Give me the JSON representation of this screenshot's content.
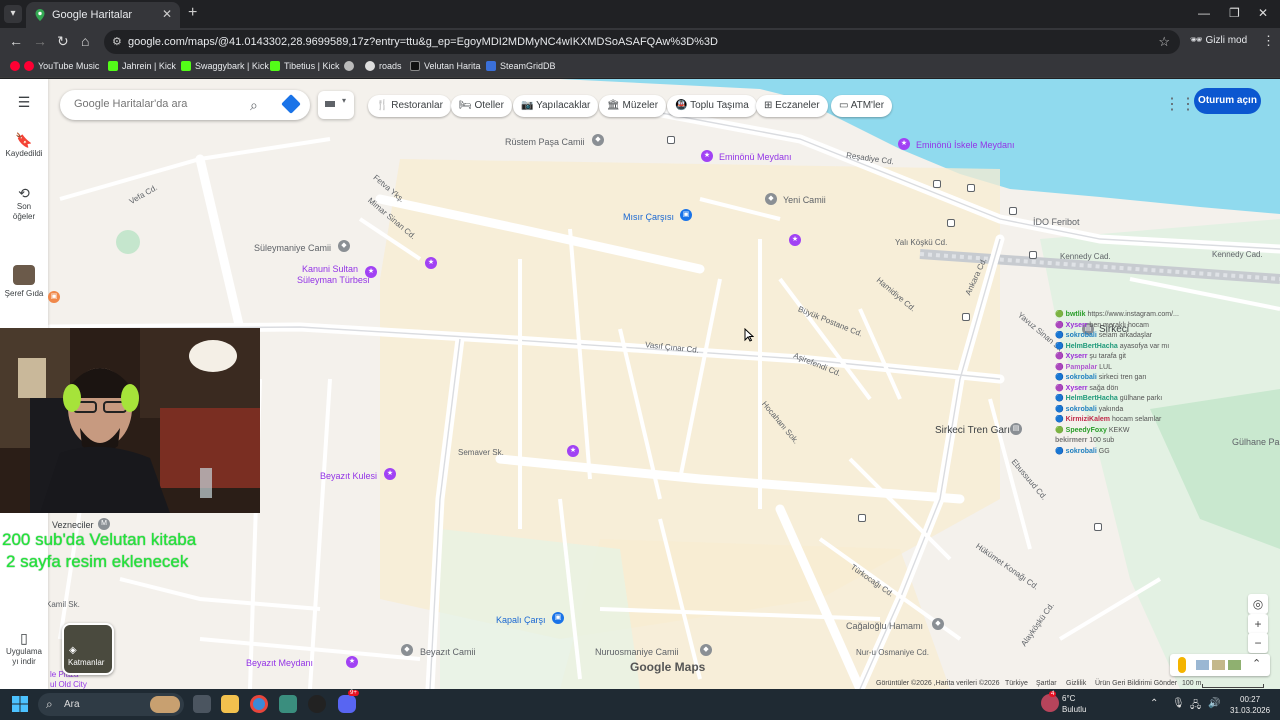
{
  "browser": {
    "tab_title": "Google Haritalar",
    "url": "google.com/maps/@41.0143302,28.9699589,17z?entry=ttu&g_ep=EgoyMDI2MDMyNC4wIKXMDSoASAFQAw%3D%3D",
    "incognito_label": "Gizli mod",
    "bookmarks": [
      "YouTube Music",
      "Jahrein | Kick",
      "Swaggybark | Kick",
      "Tibetius | Kick",
      "roads",
      "Velutan Harita",
      "SteamGridDB"
    ]
  },
  "maps": {
    "search_placeholder": "Google Haritalar'da ara",
    "chips": [
      "Restoranlar",
      "Oteller",
      "Yapılacaklar",
      "Müzeler",
      "Toplu Taşıma",
      "Eczaneler",
      "ATM'ler"
    ],
    "signin_label": "Oturum açın",
    "sidebar": {
      "saved": "Kaydedildi",
      "recent": "Son öğeler",
      "recent_item": "Şeref Gıda",
      "get_app": "Uygulama yı indir"
    },
    "layers_label": "Katmanlar",
    "logo": "Google Maps",
    "attribution": {
      "imagery": "Görüntüler ©2026 ,Harita verileri ©2026",
      "country": "Türkiye",
      "terms": "Şartlar",
      "privacy": "Gizlilik",
      "feedback": "Ürün Geri Bildirimi Gönder",
      "scale": "100 m"
    },
    "places": {
      "rustem_pasa": "Rüstem Paşa Camii",
      "eminonu_meydani": "Eminönü Meydanı",
      "eminonu_iskele": "Eminönü İskele Meydanı",
      "yeni_camii": "Yeni Camii",
      "misir_carsisi": "Mısır Çarşısı",
      "suleymaniye": "Süleymaniye Camii",
      "kanuni_1": "Kanuni Sultan",
      "kanuni_2": "Süleyman Türbesi",
      "ido": "İDO Feribot",
      "sirkeci": "Sirkeci",
      "sirkeci_tren": "Sirkeci Tren Garı",
      "beyazit_kulesi": "Beyazıt Kulesi",
      "vezneciler": "Vezneciler",
      "kapali_carsi": "Kapalı Çarşı",
      "beyazit_camii": "Beyazıt Camii",
      "nuruosmaniye": "Nuruosmaniye Camii",
      "cagaloglu": "Cağaloğlu Hamamı",
      "nuru_osmaniye_cd": "Nur-u Osmaniye Cd.",
      "beyazit_meydani": "Beyazıt Meydanı",
      "gulhane": "Gülhane Pa",
      "old_city_1": "le Plaza",
      "old_city_2": "ul Old City"
    },
    "streets": [
      "Reşadiye Cd.",
      "Kennedy Cad.",
      "Kennedy Cad.",
      "Vasıf Çınar Cd.",
      "Hamidiye Cd.",
      "Büyük Postane Cd.",
      "Aşirefendi Cd.",
      "Hocahanı Sok.",
      "Semaver Sk.",
      "Fetva Ykş.",
      "Vefa Cd.",
      "Mimar Sinan Cd.",
      "Yavuz Sinan Sk.",
      "Hükümet Konağı Cd.",
      "Türkocağı Cd.",
      "Alayköşkü Cd.",
      "Ebussuud Cd.",
      "Ankara Cd.",
      "Yalı Köşkü Cd.",
      "Kamil Sk."
    ]
  },
  "stream_overlay": {
    "line1": "200 sub'da Velutan kitaba",
    "line2": "2 sayfa resim eklenecek",
    "chat": [
      {
        "name": "bwtlik",
        "msg": "https://www.instagram.com/..."
      },
      {
        "name": "Xyserr",
        "msg": "ben meraklı hocam"
      },
      {
        "name": "sokrobali",
        "msg": "selam arkadaşlar"
      },
      {
        "name": "HelmBertHacha",
        "msg": "ayasofya var mı"
      },
      {
        "name": "Xyserr",
        "msg": "şu tarafa git"
      },
      {
        "name": "Pampalar",
        "msg": "LUL"
      },
      {
        "name": "sokrobali",
        "msg": "sirkeci tren garı"
      },
      {
        "name": "Xyserr",
        "msg": "sağa dön"
      },
      {
        "name": "HelmBertHacha",
        "msg": "gülhane parkı"
      },
      {
        "name": "sokrobali",
        "msg": "yakında"
      },
      {
        "name": "KirmiziKalem",
        "msg": "hocam selamlar"
      },
      {
        "name": "SpeedyFoxy",
        "msg": "KEKW"
      },
      {
        "name": "bekirmerr",
        "msg": "100 sub"
      },
      {
        "name": "sokrobali",
        "msg": "GG"
      }
    ]
  },
  "taskbar": {
    "search_label": "Ara",
    "weather_temp": "6°C",
    "weather_desc": "Bulutlu",
    "time": "00:27",
    "date": "31.03.2026",
    "notification_badge": "4",
    "discord_badge": "9+"
  }
}
